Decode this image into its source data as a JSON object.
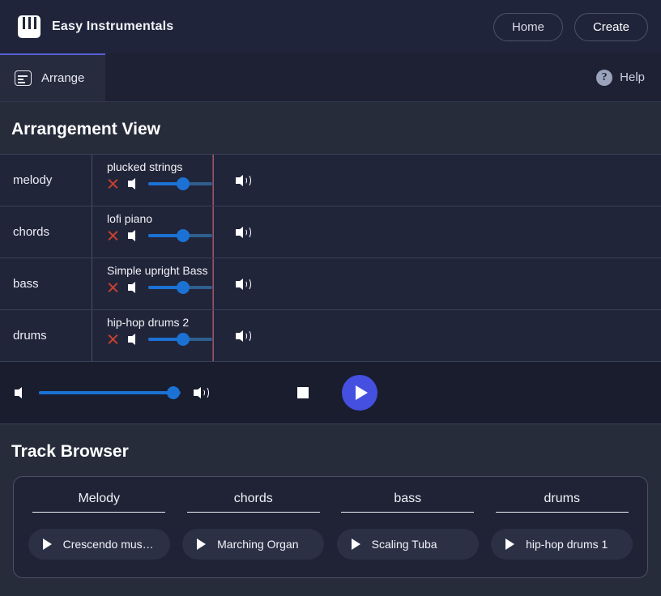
{
  "header": {
    "logo_icon": "piano-keyboard-icon",
    "title": "Easy Instrumentals",
    "home_label": "Home",
    "create_label": "Create"
  },
  "tabbar": {
    "tabs": [
      {
        "label": "Arrange",
        "icon": "arrange-list-icon",
        "active": true
      }
    ],
    "help_label": "Help",
    "help_icon": "question-mark-icon"
  },
  "arrangement": {
    "title": "Arrangement View",
    "playhead_color": "#b54a52",
    "rows": [
      {
        "label": "melody",
        "clip_name": "plucked strings",
        "remove_icon": "close-x-icon",
        "mute_icon": "volume-low-icon",
        "output_icon": "volume-high-icon",
        "volume": 55
      },
      {
        "label": "chords",
        "clip_name": "lofi piano",
        "remove_icon": "close-x-icon",
        "mute_icon": "volume-low-icon",
        "output_icon": "volume-high-icon",
        "volume": 55
      },
      {
        "label": "bass",
        "clip_name": "Simple upright Bass",
        "remove_icon": "close-x-icon",
        "mute_icon": "volume-low-icon",
        "output_icon": "volume-high-icon",
        "volume": 55
      },
      {
        "label": "drums",
        "clip_name": "hip-hop drums 2",
        "remove_icon": "close-x-icon",
        "mute_icon": "volume-low-icon",
        "output_icon": "volume-high-icon",
        "volume": 55
      }
    ]
  },
  "transport": {
    "mute_icon": "volume-low-icon",
    "output_icon": "volume-high-icon",
    "master_volume": 95,
    "stop_icon": "stop-square-icon",
    "play_icon": "play-triangle-icon",
    "play_color": "#4550e0"
  },
  "browser": {
    "title": "Track Browser",
    "columns": [
      {
        "title": "Melody",
        "items": [
          {
            "label": "Crescendo mus…",
            "icon": "play-triangle-icon"
          }
        ]
      },
      {
        "title": "chords",
        "items": [
          {
            "label": "Marching Organ",
            "icon": "play-triangle-icon"
          }
        ]
      },
      {
        "title": "bass",
        "items": [
          {
            "label": "Scaling Tuba",
            "icon": "play-triangle-icon"
          }
        ]
      },
      {
        "title": "drums",
        "items": [
          {
            "label": "hip-hop drums 1",
            "icon": "play-triangle-icon"
          }
        ]
      }
    ]
  }
}
